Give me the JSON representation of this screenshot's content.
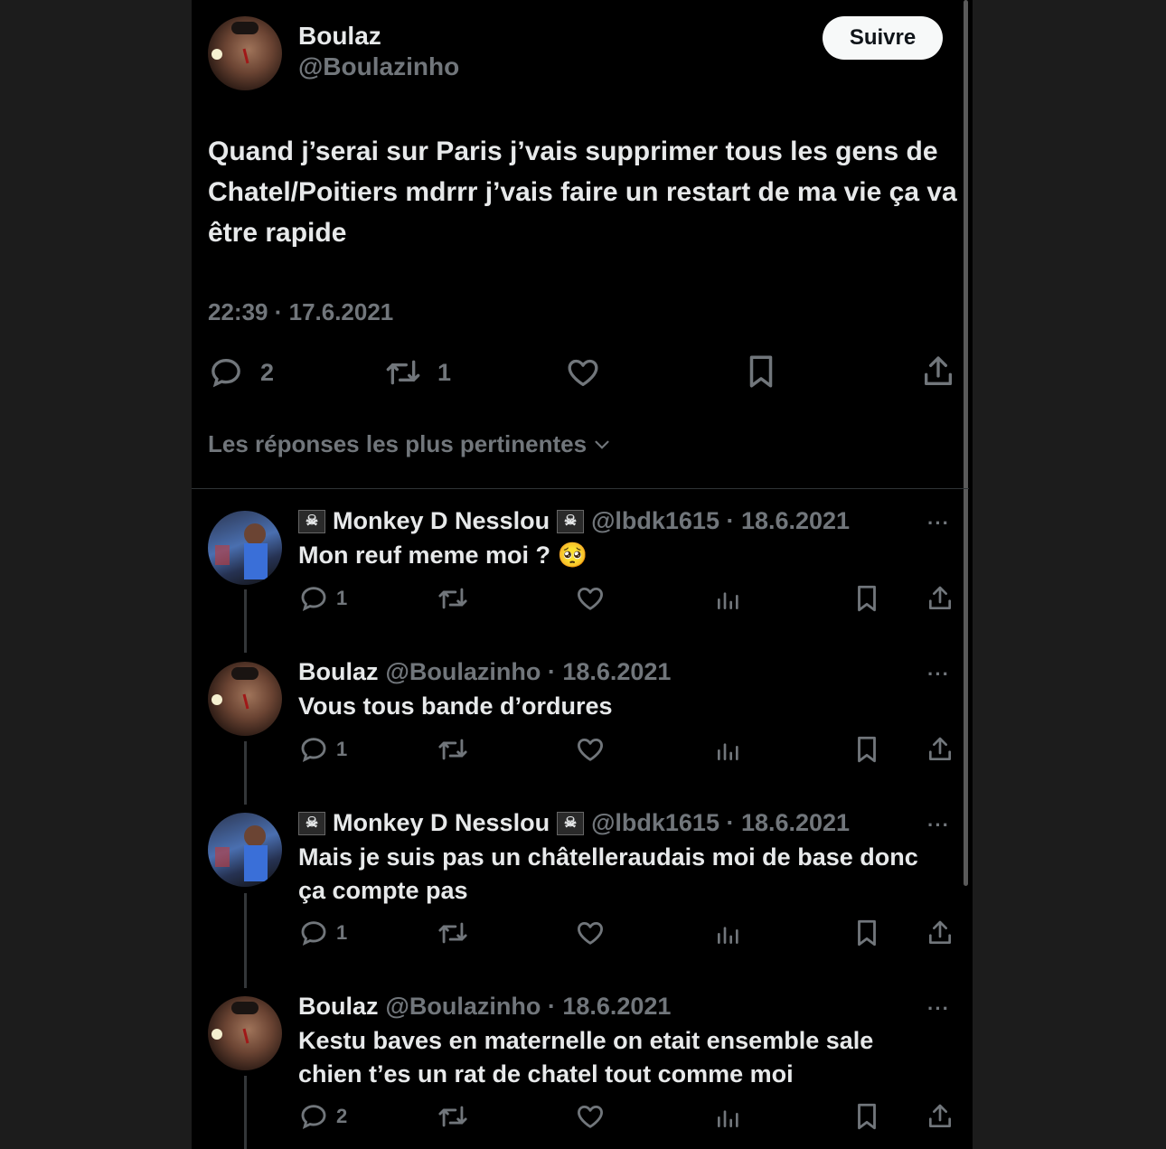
{
  "main_tweet": {
    "author_name": "Boulaz",
    "author_handle": "@Boulazinho",
    "follow_label": "Suivre",
    "text": "Quand j’serai sur Paris j’vais supprimer tous les gens de Chatel/Poitiers mdrrr j’vais faire un restart de ma vie ça va être rapide",
    "timestamp": "22:39 · 17.6.2021",
    "reply_count": "2",
    "retweet_count": "1",
    "icons": [
      "reply-icon",
      "retweet-icon",
      "like-icon",
      "bookmark-icon",
      "share-icon"
    ]
  },
  "sort_label": "Les réponses les plus pertinentes",
  "replies": [
    {
      "name": "Monkey D Nesslou",
      "flag": "☠",
      "meta": "@lbdk1615 · 18.6.2021",
      "text": "Mon reuf meme moi ? 🥺",
      "reply_count": "1"
    },
    {
      "name": "Boulaz",
      "meta": "@Boulazinho · 18.6.2021",
      "text": "Vous tous bande d’ordures",
      "reply_count": "1"
    },
    {
      "name": "Monkey D Nesslou",
      "flag": "☠",
      "meta": "@lbdk1615 · 18.6.2021",
      "text": "Mais je suis pas un châtelleraudais moi de base donc ça compte pas",
      "reply_count": "1"
    },
    {
      "name": "Boulaz",
      "meta": "@Boulazinho · 18.6.2021",
      "text": "Kestu baves en maternelle on etait ensemble sale chien t’es un rat de chatel tout comme moi",
      "reply_count": "2"
    }
  ],
  "more_label": "···",
  "colors": {
    "background": "#000000",
    "text": "#e7e9ea",
    "muted": "#71767b",
    "follow_bg": "#f7f9f9"
  }
}
